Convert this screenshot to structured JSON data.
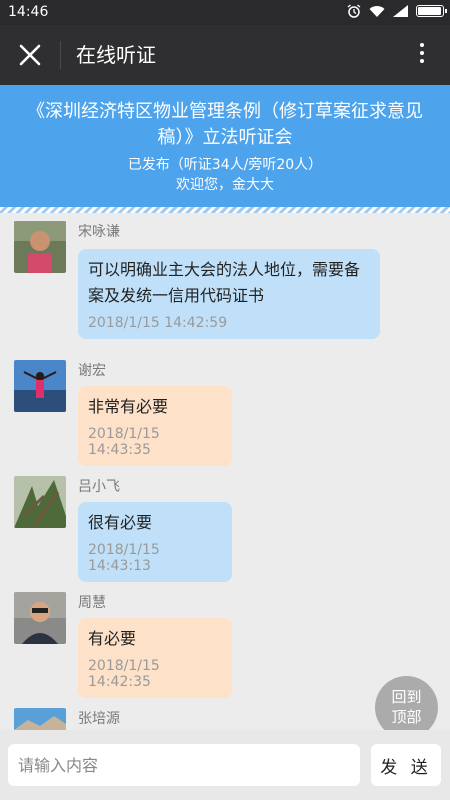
{
  "status_bar": {
    "time": "14:46"
  },
  "header": {
    "title": "在线听证"
  },
  "banner": {
    "title": "《深圳经济特区物业管理条例（修订草案征求意见稿）》立法听证会",
    "status": "已发布（听证34人/旁听20人）",
    "welcome": "欢迎您，金大大"
  },
  "messages": [
    {
      "sender": "宋咏谦",
      "text": "可以明确业主大会的法人地位，需要备案及发统一信用代码证书",
      "time": "2018/1/15 14:42:59",
      "color": "#bfe0f8"
    },
    {
      "sender": "谢宏",
      "text": "非常有必要",
      "time": "2018/1/15 14:43:35",
      "color": "#fde1c8"
    },
    {
      "sender": "吕小飞",
      "text": "很有必要",
      "time": "2018/1/15 14:43:13",
      "color": "#bfe0f8"
    },
    {
      "sender": "周慧",
      "text": "有必要",
      "time": "2018/1/15 14:42:35",
      "color": "#fde1c8"
    },
    {
      "sender": "张培源"
    }
  ],
  "back_to_top": {
    "line1": "回到",
    "line2": "顶部"
  },
  "input": {
    "placeholder": "请输入内容"
  },
  "send_label": "发 送",
  "colors": {
    "banner": "#4da3ec",
    "title_bar": "#2f2f31",
    "bubble_blue": "#bfe0f8",
    "bubble_orange": "#fde1c8"
  }
}
